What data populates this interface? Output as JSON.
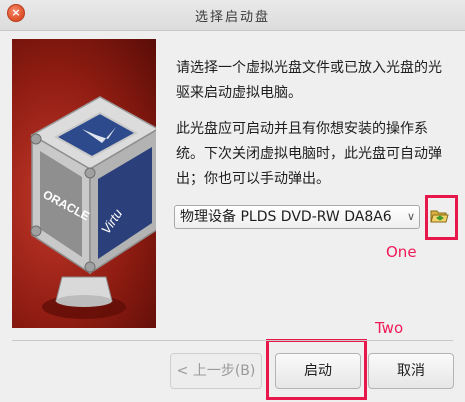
{
  "window": {
    "title": "选择启动盘",
    "close_glyph": "×"
  },
  "banner": {
    "brand_text": "ORACLE",
    "cube_text": "Virtu"
  },
  "description": {
    "paragraph1": "请选择一个虚拟光盘文件或已放入光盘的光驱来启动虚拟电脑。",
    "paragraph2": "此光盘应可启动并且有你想安装的操作系统。下次关闭虚拟电脑时，此光盘可自动弹出；你也可以手动弹出。"
  },
  "drive_select": {
    "selected": "物理设备 PLDS DVD-RW DA8A6",
    "arrow": "∨"
  },
  "browse_button": {
    "icon": "folder-open-icon"
  },
  "annotations": {
    "one": "One",
    "two": "Two",
    "color": "#e8174b"
  },
  "buttons": {
    "back": "< 上一步(B)",
    "start": "启动",
    "cancel": "取消"
  }
}
